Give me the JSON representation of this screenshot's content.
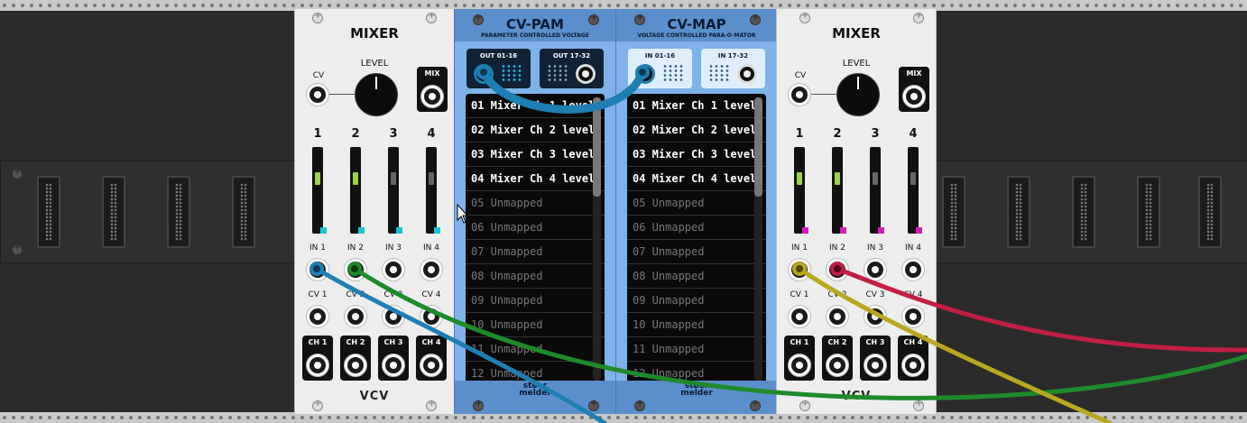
{
  "mixers": [
    {
      "title": "MIXER",
      "level_label": "LEVEL",
      "cv_label": "CV",
      "mix_label": "MIX",
      "channels": [
        "1",
        "2",
        "3",
        "4"
      ],
      "in_labels": [
        "IN 1",
        "IN 2",
        "IN 3",
        "IN 4"
      ],
      "cv_labels": [
        "CV 1",
        "CV 2",
        "CV 3",
        "CV 4"
      ],
      "ch_labels": [
        "CH 1",
        "CH 2",
        "CH 3",
        "CH 4"
      ],
      "logo": "VCV"
    },
    {
      "title": "MIXER",
      "level_label": "LEVEL",
      "cv_label": "CV",
      "mix_label": "MIX",
      "channels": [
        "1",
        "2",
        "3",
        "4"
      ],
      "in_labels": [
        "IN 1",
        "IN 2",
        "IN 3",
        "IN 4"
      ],
      "cv_labels": [
        "CV 1",
        "CV 2",
        "CV 3",
        "CV 4"
      ],
      "ch_labels": [
        "CH 1",
        "CH 2",
        "CH 3",
        "CH 4"
      ],
      "logo": "VCV"
    }
  ],
  "cv_pam": {
    "title": "CV-PAM",
    "subtitle": "PARAMETER CONTROLLED VOLTAGE",
    "port1_label": "OUT 01-16",
    "port2_label": "OUT 17-32",
    "brand": "støer melder",
    "rows": [
      "01 Mixer Ch 1 level",
      "02 Mixer Ch 2 level",
      "03 Mixer Ch 3 level",
      "04 Mixer Ch 4 level",
      "05 Unmapped",
      "06 Unmapped",
      "07 Unmapped",
      "08 Unmapped",
      "09 Unmapped",
      "10 Unmapped",
      "11 Unmapped",
      "12 Unmapped"
    ]
  },
  "cv_map": {
    "title": "CV-MAP",
    "subtitle": "VOLTAGE CONTROLLED PARA-O-MATOR",
    "port1_label": "IN 01-16",
    "port2_label": "IN 17-32",
    "brand": "støer melder",
    "rows": [
      "01 Mixer Ch 1 level",
      "02 Mixer Ch 2 level",
      "03 Mixer Ch 3 level",
      "04 Mixer Ch 4 level",
      "05 Unmapped",
      "06 Unmapped",
      "07 Unmapped",
      "08 Unmapped",
      "09 Unmapped",
      "10 Unmapped",
      "11 Unmapped",
      "12 Unmapped"
    ]
  },
  "colors": {
    "cable_blue": "#1f7fb3",
    "cable_green": "#1f8a2a",
    "cable_yellow": "#b8a81f",
    "cable_red": "#c21f45",
    "led_cyan": "#19c4d8",
    "led_magenta": "#d01fb7",
    "panel_blue": "#7fb2e8"
  }
}
